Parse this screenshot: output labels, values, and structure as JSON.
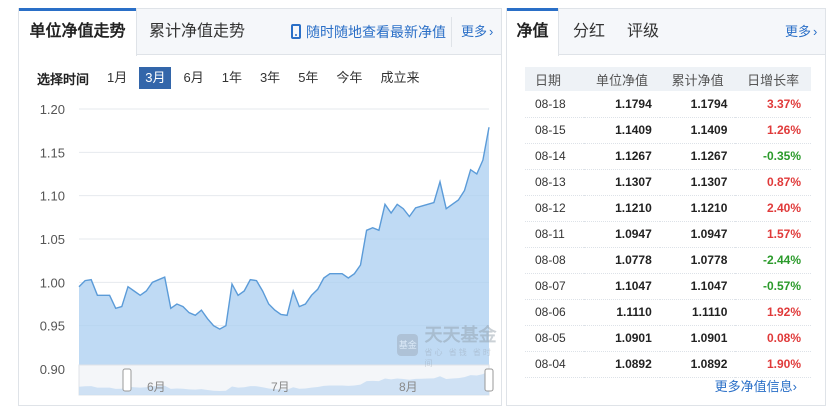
{
  "left_panel": {
    "tabs": [
      {
        "label": "单位净值走势",
        "active": true
      },
      {
        "label": "累计净值走势",
        "active": false
      }
    ],
    "phone_link": "随时随地查看最新净值",
    "more": "更多"
  },
  "range": {
    "label": "选择时间",
    "options": [
      {
        "label": "1月",
        "active": false
      },
      {
        "label": "3月",
        "active": true
      },
      {
        "label": "6月",
        "active": false
      },
      {
        "label": "1年",
        "active": false
      },
      {
        "label": "3年",
        "active": false
      },
      {
        "label": "5年",
        "active": false
      },
      {
        "label": "今年",
        "active": false
      },
      {
        "label": "成立来",
        "active": false
      }
    ]
  },
  "watermark": {
    "logo": "基金",
    "text": "天天基金",
    "sub": "省心 省钱 省时间"
  },
  "chart_data": {
    "type": "area",
    "y_ticks": [
      "1.20",
      "1.15",
      "1.10",
      "1.05",
      "1.00",
      "0.95",
      "0.90"
    ],
    "ylim": [
      0.9,
      1.2
    ],
    "navigator_labels": [
      "6月",
      "7月",
      "8月"
    ],
    "values": [
      0.995,
      1.002,
      1.003,
      0.985,
      0.985,
      0.985,
      0.97,
      0.972,
      0.995,
      0.99,
      0.985,
      0.99,
      1.0,
      1.003,
      1.006,
      0.97,
      0.975,
      0.972,
      0.965,
      0.962,
      0.968,
      0.958,
      0.95,
      0.946,
      0.95,
      0.998,
      0.985,
      0.99,
      1.003,
      1.002,
      0.99,
      0.975,
      0.968,
      0.963,
      0.962,
      0.99,
      0.972,
      0.975,
      0.985,
      0.992,
      1.005,
      1.01,
      1.01,
      1.01,
      1.005,
      1.01,
      1.02,
      1.06,
      1.063,
      1.06,
      1.09,
      1.08,
      1.09,
      1.085,
      1.076,
      1.086,
      1.088,
      1.09,
      1.092,
      1.116,
      1.085,
      1.09,
      1.095,
      1.106,
      1.13,
      1.125,
      1.141,
      1.179
    ]
  },
  "right_panel": {
    "tabs": [
      {
        "label": "净值",
        "active": true
      },
      {
        "label": "分红",
        "active": false
      },
      {
        "label": "评级",
        "active": false
      }
    ],
    "more": "更多",
    "table": {
      "headers": [
        "日期",
        "单位净值",
        "累计净值",
        "日增长率"
      ],
      "rows": [
        {
          "date": "08-18",
          "nav": "1.1794",
          "acc": "1.1794",
          "rate": "3.37%",
          "dir": "up"
        },
        {
          "date": "08-15",
          "nav": "1.1409",
          "acc": "1.1409",
          "rate": "1.26%",
          "dir": "up"
        },
        {
          "date": "08-14",
          "nav": "1.1267",
          "acc": "1.1267",
          "rate": "-0.35%",
          "dir": "down"
        },
        {
          "date": "08-13",
          "nav": "1.1307",
          "acc": "1.1307",
          "rate": "0.87%",
          "dir": "up"
        },
        {
          "date": "08-12",
          "nav": "1.1210",
          "acc": "1.1210",
          "rate": "2.40%",
          "dir": "up"
        },
        {
          "date": "08-11",
          "nav": "1.0947",
          "acc": "1.0947",
          "rate": "1.57%",
          "dir": "up"
        },
        {
          "date": "08-08",
          "nav": "1.0778",
          "acc": "1.0778",
          "rate": "-2.44%",
          "dir": "down"
        },
        {
          "date": "08-07",
          "nav": "1.1047",
          "acc": "1.1047",
          "rate": "-0.57%",
          "dir": "down"
        },
        {
          "date": "08-06",
          "nav": "1.1110",
          "acc": "1.1110",
          "rate": "1.92%",
          "dir": "up"
        },
        {
          "date": "08-05",
          "nav": "1.0901",
          "acc": "1.0901",
          "rate": "0.08%",
          "dir": "up"
        },
        {
          "date": "08-04",
          "nav": "1.0892",
          "acc": "1.0892",
          "rate": "1.90%",
          "dir": "up"
        }
      ]
    },
    "more_nav": "更多净值信息"
  },
  "colors": {
    "accent": "#2a6fc7",
    "active_range": "#3366aa",
    "up": "#e03a3a",
    "down": "#2a9a2a",
    "area": "#8fbbe6",
    "line": "#5b9bd8"
  },
  "icons": {
    "phone": "phone-icon",
    "more": "chevron-right-icon"
  }
}
